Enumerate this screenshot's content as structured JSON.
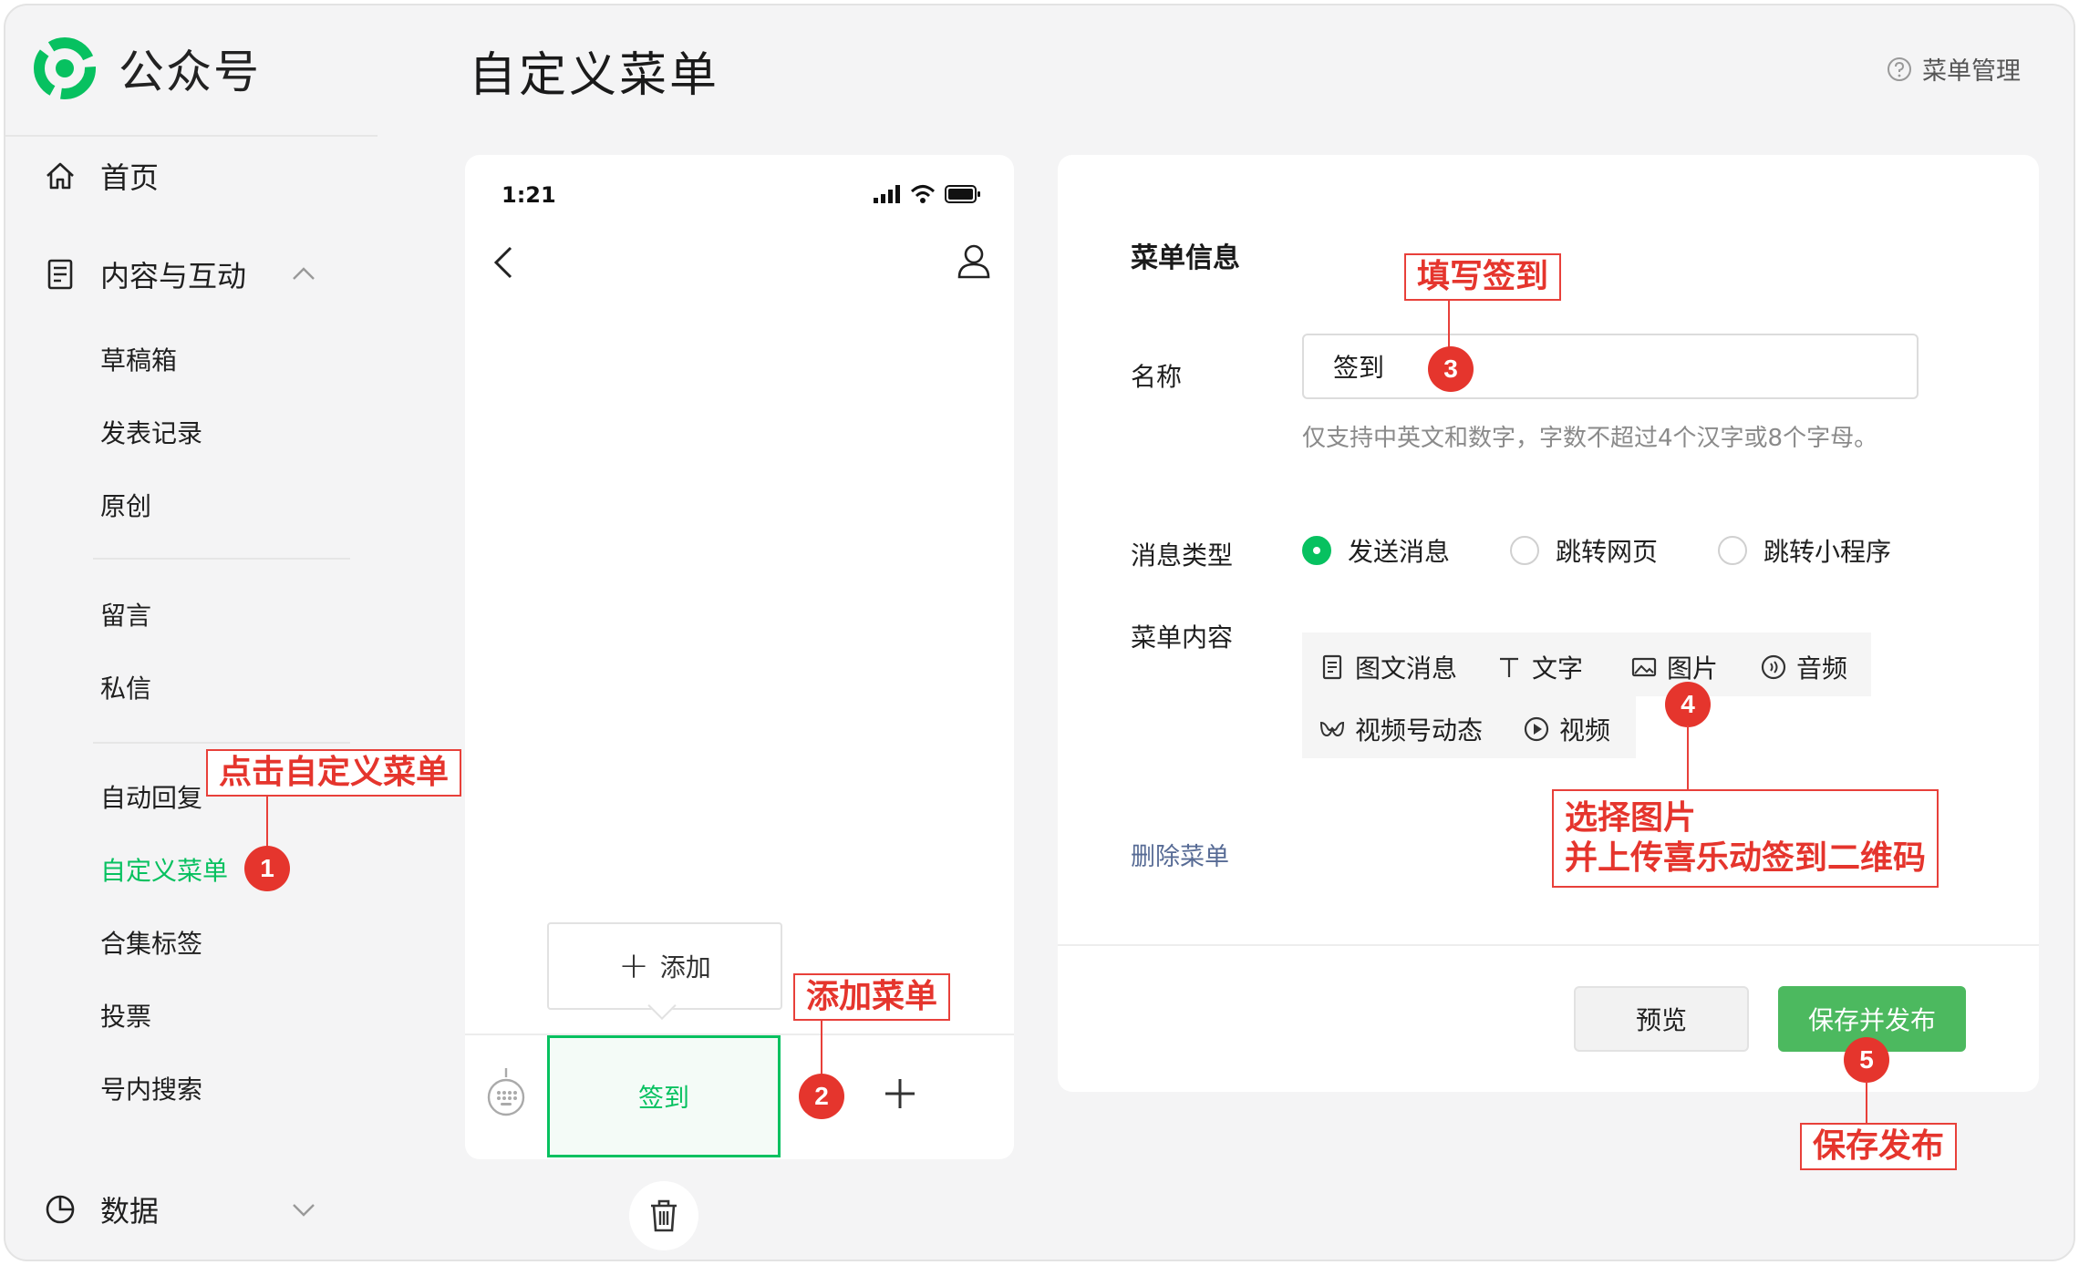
{
  "app": {
    "brand_title": "公众号",
    "logo_icon": "wechat-official-account-logo",
    "accent_color": "#07c160"
  },
  "sidebar": {
    "home": "首页",
    "content_group": "内容与互动",
    "content_items": [
      "草稿箱",
      "发表记录",
      "原创"
    ],
    "interaction_items": [
      "留言",
      "私信"
    ],
    "feature_items": [
      "自动回复",
      "自定义菜单",
      "合集标签",
      "投票",
      "号内搜索"
    ],
    "active_item": "自定义菜单",
    "data_group": "数据"
  },
  "header": {
    "title": "自定义菜单",
    "help_label": "菜单管理"
  },
  "phone": {
    "time": "1:21",
    "add_label": "添加",
    "menu_item": "签到"
  },
  "form": {
    "section_title": "菜单信息",
    "name_label": "名称",
    "name_value": "签到",
    "name_hint": "仅支持中英文和数字，字数不超过4个汉字或8个字母。",
    "type_label": "消息类型",
    "type_options": [
      "发送消息",
      "跳转网页",
      "跳转小程序"
    ],
    "type_selected": "发送消息",
    "content_label": "菜单内容",
    "content_types": [
      "图文消息",
      "文字",
      "图片",
      "音频",
      "视频号动态",
      "视频"
    ],
    "delete_label": "删除菜单",
    "preview_label": "预览",
    "publish_label": "保存并发布",
    "publish_color": "#4cb95f"
  },
  "annotations": {
    "click_menu": "点击自定义菜单",
    "add_menu": "添加菜单",
    "fill_signin": "填写签到",
    "choose_image_line1": "选择图片",
    "choose_image_line2": "并上传喜乐动签到二维码",
    "save_publish": "保存发布",
    "steps": [
      "1",
      "2",
      "3",
      "4",
      "5"
    ],
    "color": "#e5352d"
  }
}
